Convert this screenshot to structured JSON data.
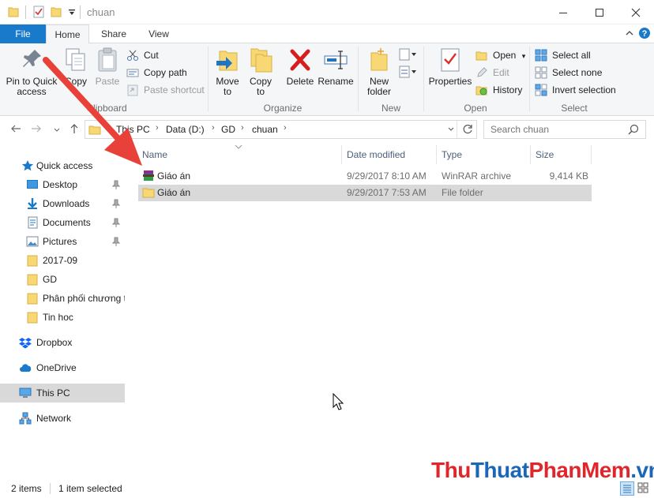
{
  "window": {
    "title": "chuan",
    "controls": [
      "minimize",
      "maximize",
      "close"
    ]
  },
  "ribbon": {
    "tabs": [
      {
        "label": "File",
        "active": false
      },
      {
        "label": "Home",
        "active": true
      },
      {
        "label": "Share",
        "active": false
      },
      {
        "label": "View",
        "active": false
      }
    ],
    "clipboard": {
      "label": "Clipboard",
      "pin_label_1": "Pin to Quick",
      "pin_label_2": "access",
      "copy": "Copy",
      "paste": "Paste",
      "cut": "Cut",
      "copy_path": "Copy path",
      "paste_shortcut": "Paste shortcut"
    },
    "organize": {
      "label": "Organize",
      "move_to_1": "Move",
      "move_to_2": "to",
      "copy_to_1": "Copy",
      "copy_to_2": "to",
      "delete": "Delete",
      "rename": "Rename"
    },
    "new": {
      "label": "New",
      "new_folder_1": "New",
      "new_folder_2": "folder"
    },
    "open": {
      "label": "Open",
      "properties": "Properties",
      "open": "Open",
      "edit": "Edit",
      "history": "History"
    },
    "select": {
      "label": "Select",
      "select_all": "Select all",
      "select_none": "Select none",
      "invert_selection": "Invert selection"
    }
  },
  "address": {
    "crumbs": [
      "This PC",
      "Data (D:)",
      "GD",
      "chuan"
    ],
    "search_placeholder": "Search chuan"
  },
  "nav": {
    "items": [
      {
        "label": "Quick access",
        "icon": "star-icon",
        "pinned": false
      },
      {
        "label": "Desktop",
        "icon": "desktop-icon",
        "pinned": true
      },
      {
        "label": "Downloads",
        "icon": "download-icon",
        "pinned": true
      },
      {
        "label": "Documents",
        "icon": "documents-icon",
        "pinned": true
      },
      {
        "label": "Pictures",
        "icon": "pictures-icon",
        "pinned": true
      },
      {
        "label": "2017-09",
        "icon": "folder-icon",
        "pinned": false
      },
      {
        "label": "GD",
        "icon": "folder-icon",
        "pinned": false
      },
      {
        "label": "Phân phối chương t",
        "icon": "folder-icon",
        "pinned": false
      },
      {
        "label": "Tin hoc",
        "icon": "folder-icon",
        "pinned": false
      },
      {
        "label": "Dropbox",
        "icon": "dropbox-icon",
        "pinned": false
      },
      {
        "label": "OneDrive",
        "icon": "cloud-icon",
        "pinned": false
      },
      {
        "label": "This PC",
        "icon": "computer-icon",
        "pinned": false
      },
      {
        "label": "Network",
        "icon": "network-icon",
        "pinned": false
      }
    ]
  },
  "filelist": {
    "columns": [
      "Name",
      "Date modified",
      "Type",
      "Size"
    ],
    "rows": [
      {
        "name": "Giáo án",
        "date": "9/29/2017 8:10 AM",
        "type": "WinRAR archive",
        "size": "9,414 KB",
        "icon": "winrar-icon",
        "selected": false
      },
      {
        "name": "Giáo án",
        "date": "9/29/2017 7:53 AM",
        "type": "File folder",
        "size": "",
        "icon": "folder-icon",
        "selected": true
      }
    ]
  },
  "status": {
    "items_count": "2 items",
    "selected_count": "1 item selected"
  },
  "watermark": {
    "part1": "Thu",
    "part2": "Thuat",
    "part3": "PhanMem",
    "part4": ".vn",
    "color_red": "#e0262b",
    "color_blue": "#1a67b8"
  },
  "colors": {
    "accent": "#1979ca",
    "selection": "#d9d9d9",
    "arrow": "#e8413a"
  }
}
